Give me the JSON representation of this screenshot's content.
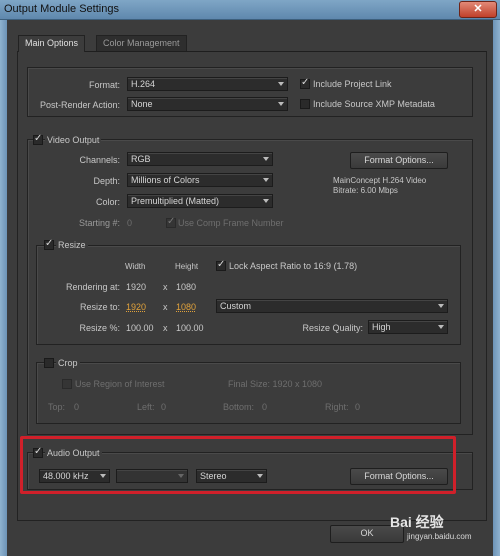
{
  "window": {
    "title": "Output Module Settings",
    "close_label": "✕"
  },
  "tabs": [
    {
      "label": "Main Options"
    },
    {
      "label": "Color Management"
    }
  ],
  "format": {
    "label": "Format:",
    "value": "H.264",
    "include_project_link": "Include Project Link",
    "post_render_label": "Post-Render Action:",
    "post_render_value": "None",
    "include_xmp": "Include Source XMP Metadata"
  },
  "video": {
    "section": "Video Output",
    "channels_label": "Channels:",
    "channels_value": "RGB",
    "depth_label": "Depth:",
    "depth_value": "Millions of Colors",
    "color_label": "Color:",
    "color_value": "Premultiplied (Matted)",
    "starting_label": "Starting #:",
    "starting_value": "0",
    "use_comp_frame": "Use Comp Frame Number",
    "format_options": "Format Options...",
    "codec_info_1": "MainConcept H.264 Video",
    "codec_info_2": "Bitrate: 6.00 Mbps"
  },
  "resize": {
    "section": "Resize",
    "width_header": "Width",
    "height_header": "Height",
    "lock_aspect": "Lock Aspect Ratio to 16:9 (1.78)",
    "rendering_label": "Rendering at:",
    "rendering_w": "1920",
    "rendering_x": "x",
    "rendering_h": "1080",
    "resize_to_label": "Resize to:",
    "resize_to_w": "1920",
    "resize_to_x": "x",
    "resize_to_h": "1080",
    "preset_value": "Custom",
    "resize_pct_label": "Resize %:",
    "resize_pct_w": "100.00",
    "resize_pct_x": "x",
    "resize_pct_h": "100.00",
    "quality_label": "Resize Quality:",
    "quality_value": "High"
  },
  "crop": {
    "section": "Crop",
    "use_roi": "Use Region of Interest",
    "final_size": "Final Size: 1920 x 1080",
    "top_label": "Top:",
    "top_value": "0",
    "left_label": "Left:",
    "left_value": "0",
    "bottom_label": "Bottom:",
    "bottom_value": "0",
    "right_label": "Right:",
    "right_value": "0"
  },
  "audio": {
    "section": "Audio Output",
    "rate_value": "48.000 kHz",
    "depth_value": "",
    "channels_value": "Stereo",
    "format_options": "Format Options..."
  },
  "footer": {
    "ok_label": "OK"
  },
  "watermark": {
    "text": "Bai 经验",
    "url": "jingyan.baidu.com"
  }
}
